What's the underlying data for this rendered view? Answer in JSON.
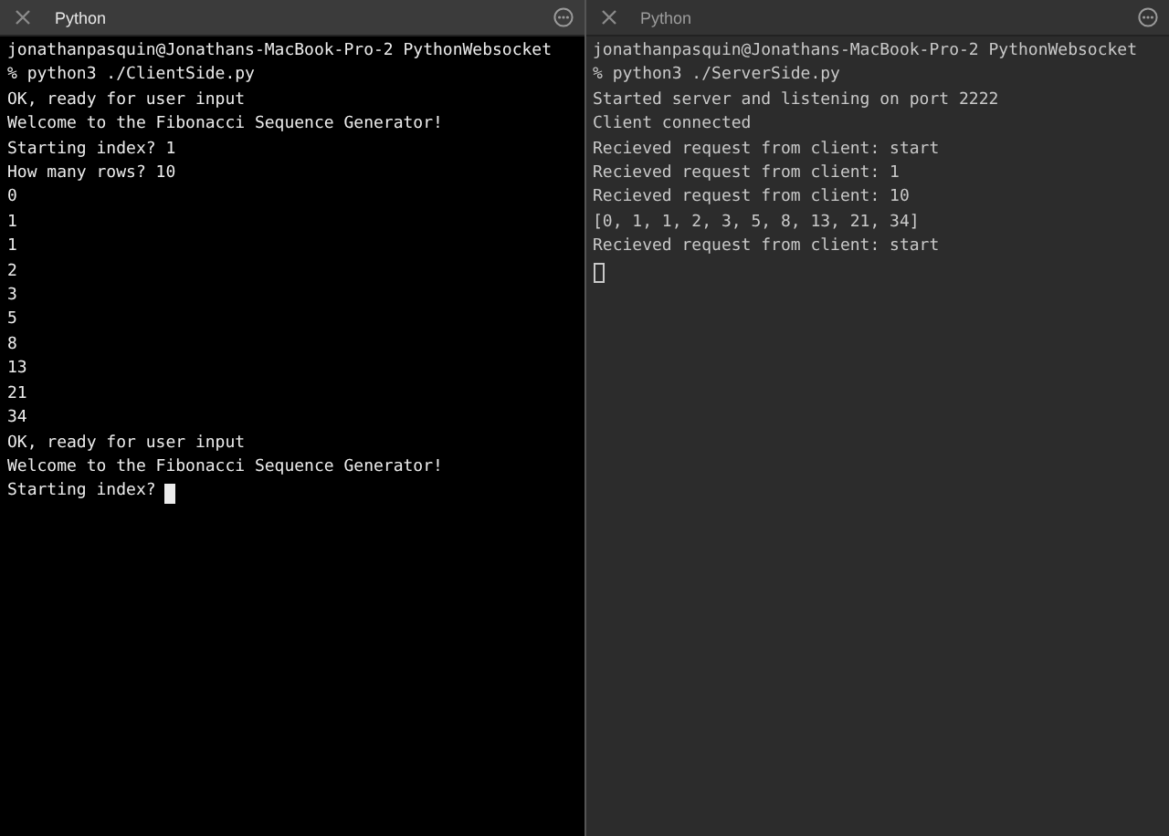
{
  "panes": [
    {
      "tab_title": "Python",
      "focused": true,
      "lines": [
        "jonathanpasquin@Jonathans-MacBook-Pro-2 PythonWebsocket",
        "% python3 ./ClientSide.py",
        "OK, ready for user input",
        "Welcome to the Fibonacci Sequence Generator!",
        "Starting index? 1",
        "How many rows? 10",
        "0",
        "1",
        "1",
        "2",
        "3",
        "5",
        "8",
        "13",
        "21",
        "34",
        "OK, ready for user input",
        "Welcome to the Fibonacci Sequence Generator!"
      ],
      "prompt": "Starting index?"
    },
    {
      "tab_title": "Python",
      "focused": false,
      "lines": [
        "jonathanpasquin@Jonathans-MacBook-Pro-2 PythonWebsocket",
        "% python3 ./ServerSide.py",
        "Started server and listening on port 2222",
        "Client connected",
        "Recieved request from client: start",
        "Recieved request from client: 1",
        "Recieved request from client: 10",
        "[0, 1, 1, 2, 3, 5, 8, 13, 21, 34]",
        "Recieved request from client: start"
      ]
    }
  ]
}
